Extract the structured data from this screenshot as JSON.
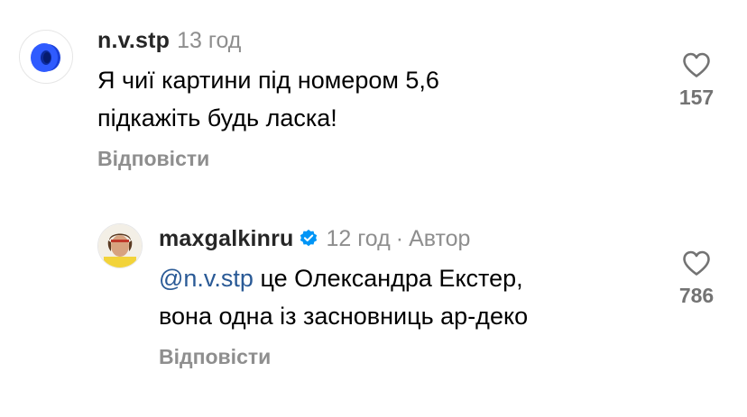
{
  "comments": [
    {
      "username": "n.v.stp",
      "time": "13 год",
      "text_lines": [
        "Я чиї картини під номером 5,6",
        "підкажіть будь ласка!"
      ],
      "reply_label": "Відповісти",
      "likes": "157",
      "avatar_icon": "blue-ring-icon"
    },
    {
      "username": "maxgalkinru",
      "verified": true,
      "time": "12 год",
      "separator": "·",
      "author_label": "Автор",
      "mention": "@n.v.stp",
      "text_line1_rest": " це Олександра Екстер,",
      "text_line2": "вона одна із засновниць ар-деко",
      "reply_label": "Відповісти",
      "likes": "786",
      "avatar_icon": "user-photo"
    }
  ],
  "colors": {
    "username": "#262626",
    "secondary": "#8e8e8e",
    "mention": "#2a5a96",
    "verified": "#0095f6"
  }
}
